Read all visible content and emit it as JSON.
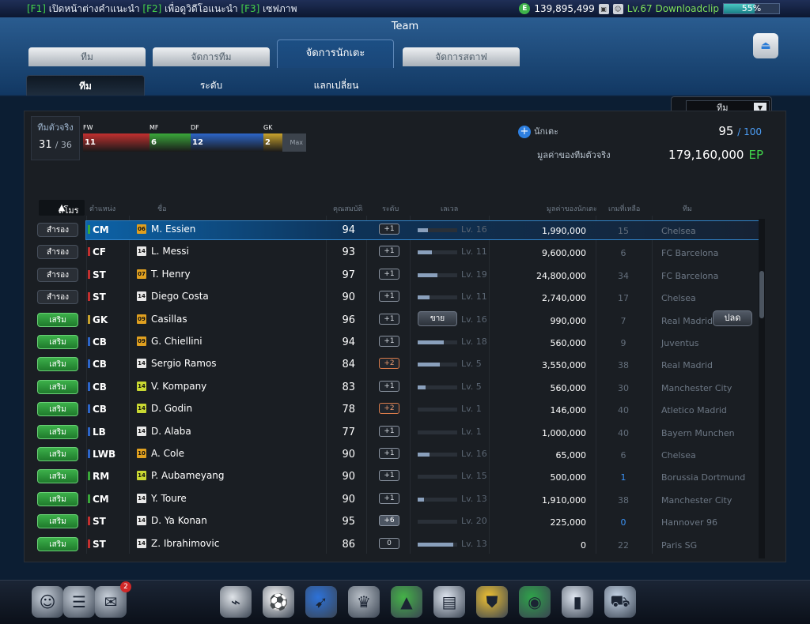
{
  "topbar": {
    "hint_parts": [
      {
        "k": "[F1]",
        "t": " เปิดหน้าต่างคำแนะนำ "
      },
      {
        "k": "[F2]",
        "t": " เพื่อดูวิดีโอแนะนำ "
      },
      {
        "k": "[F3]",
        "t": " เซฟภาพ"
      }
    ],
    "money": "139,895,499",
    "level_text": "Lv.67 Downloadclip",
    "progress_percent": "55%",
    "progress_value": 0.55
  },
  "window": {
    "title": "Team",
    "tabs": [
      "ทีม",
      "จัดการทีม",
      "จัดการนักเตะ",
      "จัดการสตาฟ"
    ],
    "active_tab": 2,
    "subtabs": [
      "ทีม",
      "ระดับ",
      "แลกเปลี่ยน"
    ]
  },
  "filter": {
    "selected": "ทีม"
  },
  "summary": {
    "real_label": "ทีมตัวจริง",
    "real_count": "31",
    "real_max": "/ 36",
    "positions": [
      {
        "label": "FW",
        "count": "11",
        "color": "#c2302f"
      },
      {
        "label": "MF",
        "count": "6",
        "color": "#3aa83a"
      },
      {
        "label": "DF",
        "count": "12",
        "color": "#2d66c9"
      },
      {
        "label": "GK",
        "count": "2",
        "color": "#c9a32d"
      }
    ],
    "max_label": "Max",
    "players_label": "นักเตะ",
    "players_count": "95",
    "players_max": "/ 100",
    "team_value_label": "มูลค่าของทีมตัวจริง",
    "team_value": "179,160,000",
    "currency": "EP"
  },
  "table": {
    "headers": {
      "club": "สโมร",
      "pos": "ตำแหน่ง",
      "name": "ชื่อ",
      "ovr": "คุณสมบัติ",
      "grade": "ระดับ",
      "level": "เลเวล",
      "value": "มูลค่าของนักเตะ",
      "left": "เกมที่เหลือ",
      "team": "ทีม"
    },
    "sell_label": "ขาย",
    "release_label": "ปลด",
    "rows": [
      {
        "status": "สำรอง",
        "type": "sub",
        "pos": "CM",
        "pc": "#3aa83a",
        "season": "06",
        "sc": "#e0a020",
        "name": "M. Essien",
        "ovr": "94",
        "grade": "+1",
        "gt": "",
        "xp": 0.25,
        "lv": "Lv. 16",
        "value": "1,990,000",
        "left": "15",
        "lb": false,
        "team": "Chelsea"
      },
      {
        "status": "สำรอง",
        "type": "sub",
        "pos": "CF",
        "pc": "#c2302f",
        "season": "14",
        "sc": "#e8e8e8",
        "name": "L. Messi",
        "ovr": "93",
        "grade": "+1",
        "gt": "",
        "xp": 0.35,
        "lv": "Lv. 11",
        "value": "9,600,000",
        "left": "6",
        "lb": false,
        "team": "FC Barcelona"
      },
      {
        "status": "สำรอง",
        "type": "sub",
        "pos": "ST",
        "pc": "#c2302f",
        "season": "07",
        "sc": "#e0a020",
        "name": "T. Henry",
        "ovr": "97",
        "grade": "+1",
        "gt": "",
        "xp": 0.5,
        "lv": "Lv. 19",
        "value": "24,800,000",
        "left": "34",
        "lb": false,
        "team": "FC Barcelona"
      },
      {
        "status": "สำรอง",
        "type": "sub",
        "pos": "ST",
        "pc": "#c2302f",
        "season": "14",
        "sc": "#e8e8e8",
        "name": "Diego Costa",
        "ovr": "90",
        "grade": "+1",
        "gt": "",
        "xp": 0.3,
        "lv": "Lv. 11",
        "value": "2,740,000",
        "left": "17",
        "lb": false,
        "team": "Chelsea"
      },
      {
        "status": "เสริม",
        "type": "res",
        "pos": "GK",
        "pc": "#c9a32d",
        "season": "09",
        "sc": "#e0a020",
        "name": "Casillas",
        "ovr": "96",
        "grade": "+1",
        "gt": "",
        "xp": 0.4,
        "lv": "Lv. 16",
        "value": "990,000",
        "left": "7",
        "lb": false,
        "team": "Real Madrid",
        "sell": true
      },
      {
        "status": "เสริม",
        "type": "res",
        "pos": "CB",
        "pc": "#2d66c9",
        "season": "09",
        "sc": "#e0a020",
        "name": "G. Chiellini",
        "ovr": "94",
        "grade": "+1",
        "gt": "",
        "xp": 0.65,
        "lv": "Lv. 18",
        "value": "560,000",
        "left": "9",
        "lb": false,
        "team": "Juventus"
      },
      {
        "status": "เสริม",
        "type": "res",
        "pos": "CB",
        "pc": "#2d66c9",
        "season": "14",
        "sc": "#e8e8e8",
        "name": "Sergio Ramos",
        "ovr": "84",
        "grade": "+2",
        "gt": "up",
        "xp": 0.55,
        "lv": "Lv. 5",
        "value": "3,550,000",
        "left": "38",
        "lb": false,
        "team": "Real Madrid"
      },
      {
        "status": "เสริม",
        "type": "res",
        "pos": "CB",
        "pc": "#2d66c9",
        "season": "14",
        "sc": "#c8d832",
        "name": "V. Kompany",
        "ovr": "83",
        "grade": "+1",
        "gt": "",
        "xp": 0.2,
        "lv": "Lv. 5",
        "value": "560,000",
        "left": "30",
        "lb": false,
        "team": "Manchester City"
      },
      {
        "status": "เสริม",
        "type": "res",
        "pos": "CB",
        "pc": "#2d66c9",
        "season": "14",
        "sc": "#c8d832",
        "name": "D. Godin",
        "ovr": "78",
        "grade": "+2",
        "gt": "up",
        "xp": 0,
        "lv": "Lv. 1",
        "value": "146,000",
        "left": "40",
        "lb": false,
        "team": "Atletico Madrid"
      },
      {
        "status": "เสริม",
        "type": "res",
        "pos": "LB",
        "pc": "#2d66c9",
        "season": "14",
        "sc": "#e8e8e8",
        "name": "D. Alaba",
        "ovr": "77",
        "grade": "+1",
        "gt": "",
        "xp": 0,
        "lv": "Lv. 1",
        "value": "1,000,000",
        "left": "40",
        "lb": false,
        "team": "Bayern Munchen"
      },
      {
        "status": "เสริม",
        "type": "res",
        "pos": "LWB",
        "pc": "#2d66c9",
        "season": "10",
        "sc": "#e0a020",
        "name": "A. Cole",
        "ovr": "90",
        "grade": "+1",
        "gt": "",
        "xp": 0.3,
        "lv": "Lv. 16",
        "value": "65,000",
        "left": "6",
        "lb": false,
        "team": "Chelsea"
      },
      {
        "status": "เสริม",
        "type": "res",
        "pos": "RM",
        "pc": "#3aa83a",
        "season": "14",
        "sc": "#c8d832",
        "name": "P. Aubameyang",
        "ovr": "90",
        "grade": "+1",
        "gt": "",
        "xp": 0,
        "lv": "Lv. 15",
        "value": "500,000",
        "left": "1",
        "lb": true,
        "team": "Borussia Dortmund"
      },
      {
        "status": "เสริม",
        "type": "res",
        "pos": "CM",
        "pc": "#3aa83a",
        "season": "14",
        "sc": "#e8e8e8",
        "name": "Y. Toure",
        "ovr": "90",
        "grade": "+1",
        "gt": "",
        "xp": 0.15,
        "lv": "Lv. 13",
        "value": "1,910,000",
        "left": "38",
        "lb": false,
        "team": "Manchester City"
      },
      {
        "status": "เสริม",
        "type": "res",
        "pos": "ST",
        "pc": "#c2302f",
        "season": "14",
        "sc": "#e8e8e8",
        "name": "D. Ya Konan",
        "ovr": "95",
        "grade": "+6",
        "gt": "hi",
        "xp": 0,
        "lv": "Lv. 20",
        "value": "225,000",
        "left": "0",
        "lb": true,
        "team": "Hannover 96"
      },
      {
        "status": "เสริม",
        "type": "res",
        "pos": "ST",
        "pc": "#c2302f",
        "season": "14",
        "sc": "#e8e8e8",
        "name": "Z. Ibrahimovic",
        "ovr": "86",
        "grade": "0",
        "gt": "",
        "xp": 0.9,
        "lv": "Lv. 13",
        "value": "0",
        "left": "22",
        "lb": false,
        "team": "Paris SG"
      }
    ]
  },
  "bottom": {
    "mail_badge": "2",
    "icons": [
      "profile-icon",
      "chat-icon",
      "mail-icon",
      "whistle-icon",
      "ball-icon",
      "boots-icon",
      "trophy-icon",
      "ranking-icon",
      "notepad-icon",
      "jersey-icon",
      "club-icon",
      "card-icon",
      "shop-cart-icon"
    ]
  }
}
